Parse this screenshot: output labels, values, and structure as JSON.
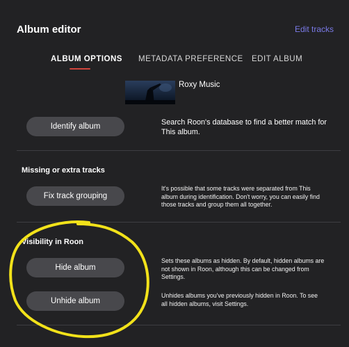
{
  "header": {
    "title": "Album editor",
    "edit_tracks": "Edit tracks"
  },
  "tabs": [
    {
      "label": "ALBUM OPTIONS",
      "active": true
    },
    {
      "label": "METADATA PREFERENCE",
      "active": false
    },
    {
      "label": "EDIT ALBUM",
      "active": false
    }
  ],
  "album": {
    "artist": "Roxy Music"
  },
  "identify": {
    "button": "Identify album",
    "description": "Search Roon's database to find a better match for This album."
  },
  "missing": {
    "heading": "Missing or extra tracks",
    "button": "Fix track grouping",
    "description": "It's possible that some tracks were separated from This album during identification. Don't worry, you can easily find those tracks and group them all together."
  },
  "visibility": {
    "heading": "Visibility in Roon",
    "hide_button": "Hide album",
    "hide_description": "Sets these albums as hidden. By default, hidden albums are not shown in Roon, although this can be changed from Settings.",
    "unhide_button": "Unhide album",
    "unhide_description": "Unhides albums you've previously hidden in Roon. To see all hidden albums, visit Settings."
  },
  "colors": {
    "background": "#222224",
    "accent_link": "#7a7ae6",
    "tab_underline": "#d0453c",
    "button": "#48484c",
    "annotation_circle": "#f2e21a"
  }
}
